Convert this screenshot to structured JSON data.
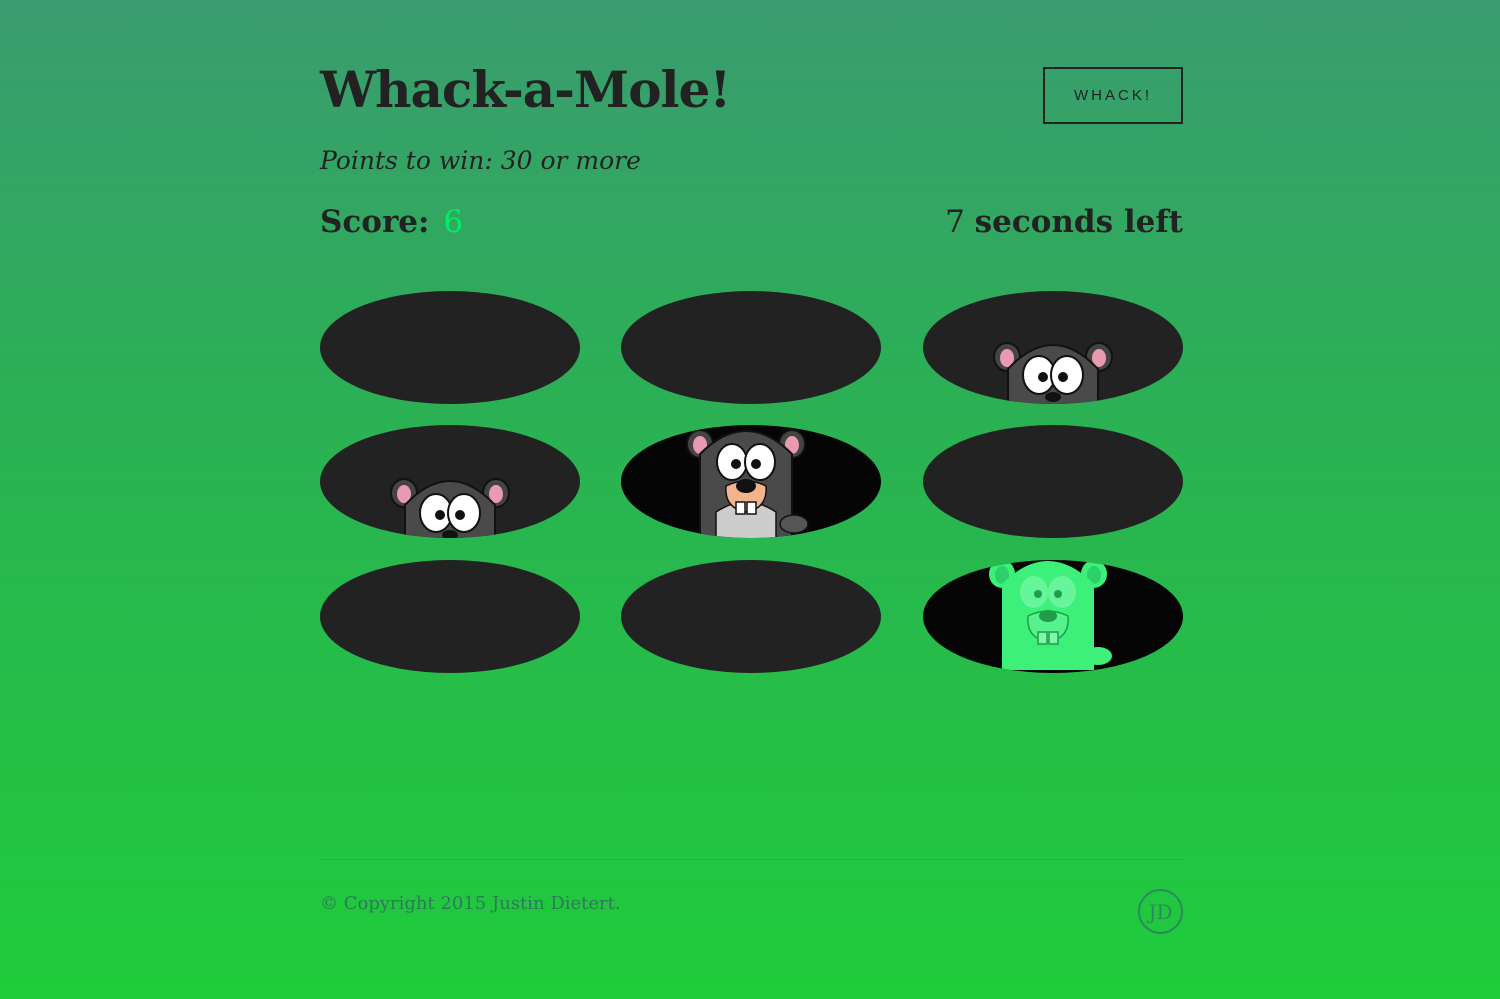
{
  "header": {
    "title": "Whack-a-Mole!",
    "whack_button": "WHACK!",
    "subtitle": "Points to win: 30 or more"
  },
  "status": {
    "score_label": "Score:",
    "score_value": "6",
    "seconds_value": "7",
    "seconds_suffix": "seconds left"
  },
  "board": {
    "holes": [
      {
        "state": "empty"
      },
      {
        "state": "empty"
      },
      {
        "state": "mole-peeking"
      },
      {
        "state": "mole-peeking"
      },
      {
        "state": "mole-up"
      },
      {
        "state": "empty"
      },
      {
        "state": "empty"
      },
      {
        "state": "empty"
      },
      {
        "state": "mole-whacked-green"
      }
    ]
  },
  "footer": {
    "copyright": "© Copyright 2015 Justin Dietert.",
    "logo_text": "JD"
  },
  "colors": {
    "score_value": "#00ee66",
    "hole": "#222222",
    "whacked_mole": "#3df07a"
  }
}
